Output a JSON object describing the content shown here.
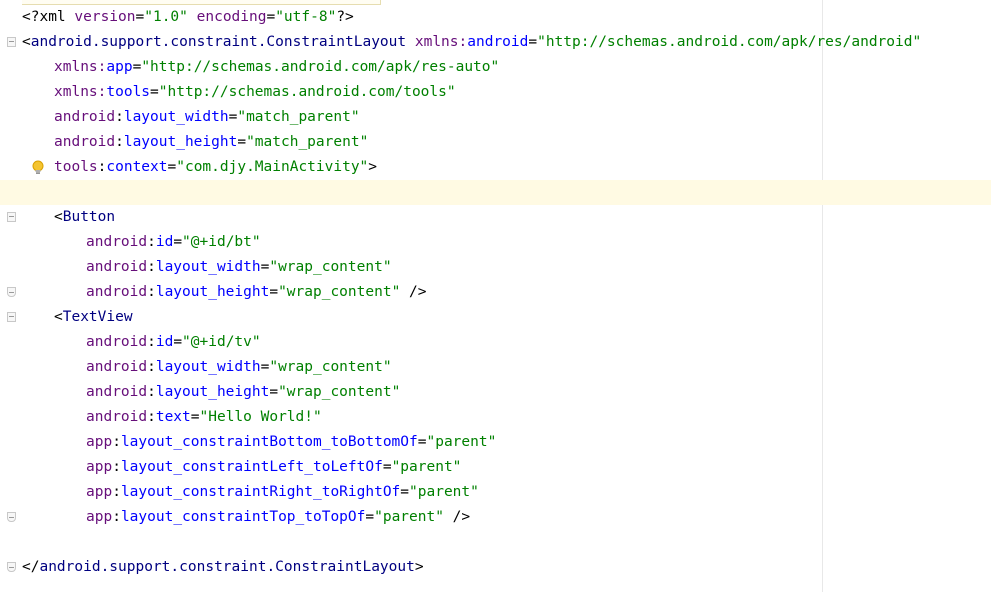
{
  "editor": {
    "lines": [
      {
        "indent": 0,
        "segments": [
          [
            "pi",
            "<?xml "
          ],
          [
            "an",
            "version"
          ],
          [
            "pi",
            "="
          ],
          [
            "av",
            "\"1.0\""
          ],
          [
            "pi",
            " "
          ],
          [
            "an",
            "encoding"
          ],
          [
            "pi",
            "="
          ],
          [
            "av",
            "\"utf-8\""
          ],
          [
            "pi",
            "?>"
          ]
        ]
      },
      {
        "indent": 0,
        "fold": "open",
        "segments": [
          [
            "bracket",
            "<"
          ],
          [
            "tag",
            "android.support.constraint.ConstraintLayout"
          ],
          [
            "pi",
            " "
          ],
          [
            "an",
            "xmlns:"
          ],
          [
            "al",
            "android"
          ],
          [
            "pi",
            "="
          ],
          [
            "av",
            "\"http://schemas.android.com/apk/res/android\""
          ]
        ]
      },
      {
        "indent": 1,
        "segments": [
          [
            "an",
            "xmlns:"
          ],
          [
            "al",
            "app"
          ],
          [
            "pi",
            "="
          ],
          [
            "av",
            "\"http://schemas.android.com/apk/res-auto\""
          ]
        ]
      },
      {
        "indent": 1,
        "segments": [
          [
            "an",
            "xmlns:"
          ],
          [
            "al",
            "tools"
          ],
          [
            "pi",
            "="
          ],
          [
            "av",
            "\"http://schemas.android.com/tools\""
          ]
        ]
      },
      {
        "indent": 1,
        "segments": [
          [
            "an",
            "android"
          ],
          [
            "pi",
            ":"
          ],
          [
            "al",
            "layout_width"
          ],
          [
            "pi",
            "="
          ],
          [
            "av",
            "\"match_parent\""
          ]
        ]
      },
      {
        "indent": 1,
        "segments": [
          [
            "an",
            "android"
          ],
          [
            "pi",
            ":"
          ],
          [
            "al",
            "layout_height"
          ],
          [
            "pi",
            "="
          ],
          [
            "av",
            "\"match_parent\""
          ]
        ]
      },
      {
        "indent": 1,
        "bulb": true,
        "segments": [
          [
            "an",
            "tools"
          ],
          [
            "pi",
            ":"
          ],
          [
            "al",
            "context"
          ],
          [
            "pi",
            "="
          ],
          [
            "av",
            "\"com.djy.MainActivity\""
          ],
          [
            "bracket",
            ">"
          ]
        ]
      },
      {
        "indent": 0,
        "current": true,
        "segments": []
      },
      {
        "indent": 1,
        "fold": "open",
        "segments": [
          [
            "bracket",
            "<"
          ],
          [
            "tag",
            "Button"
          ]
        ]
      },
      {
        "indent": 2,
        "segments": [
          [
            "an",
            "android"
          ],
          [
            "pi",
            ":"
          ],
          [
            "al",
            "id"
          ],
          [
            "pi",
            "="
          ],
          [
            "av",
            "\"@+id/bt\""
          ]
        ]
      },
      {
        "indent": 2,
        "segments": [
          [
            "an",
            "android"
          ],
          [
            "pi",
            ":"
          ],
          [
            "al",
            "layout_width"
          ],
          [
            "pi",
            "="
          ],
          [
            "av",
            "\"wrap_content\""
          ]
        ]
      },
      {
        "indent": 2,
        "fold": "close",
        "segments": [
          [
            "an",
            "android"
          ],
          [
            "pi",
            ":"
          ],
          [
            "al",
            "layout_height"
          ],
          [
            "pi",
            "="
          ],
          [
            "av",
            "\"wrap_content\""
          ],
          [
            "pi",
            " />"
          ]
        ]
      },
      {
        "indent": 1,
        "fold": "open",
        "segments": [
          [
            "bracket",
            "<"
          ],
          [
            "tag",
            "TextView"
          ]
        ]
      },
      {
        "indent": 2,
        "segments": [
          [
            "an",
            "android"
          ],
          [
            "pi",
            ":"
          ],
          [
            "al",
            "id"
          ],
          [
            "pi",
            "="
          ],
          [
            "av",
            "\"@+id/tv\""
          ]
        ]
      },
      {
        "indent": 2,
        "segments": [
          [
            "an",
            "android"
          ],
          [
            "pi",
            ":"
          ],
          [
            "al",
            "layout_width"
          ],
          [
            "pi",
            "="
          ],
          [
            "av",
            "\"wrap_content\""
          ]
        ]
      },
      {
        "indent": 2,
        "segments": [
          [
            "an",
            "android"
          ],
          [
            "pi",
            ":"
          ],
          [
            "al",
            "layout_height"
          ],
          [
            "pi",
            "="
          ],
          [
            "av",
            "\"wrap_content\""
          ]
        ]
      },
      {
        "indent": 2,
        "segments": [
          [
            "an",
            "android"
          ],
          [
            "pi",
            ":"
          ],
          [
            "al",
            "text"
          ],
          [
            "pi",
            "="
          ],
          [
            "av",
            "\"Hello World!\""
          ]
        ]
      },
      {
        "indent": 2,
        "segments": [
          [
            "an",
            "app"
          ],
          [
            "pi",
            ":"
          ],
          [
            "al",
            "layout_constraintBottom_toBottomOf"
          ],
          [
            "pi",
            "="
          ],
          [
            "av",
            "\"parent\""
          ]
        ]
      },
      {
        "indent": 2,
        "segments": [
          [
            "an",
            "app"
          ],
          [
            "pi",
            ":"
          ],
          [
            "al",
            "layout_constraintLeft_toLeftOf"
          ],
          [
            "pi",
            "="
          ],
          [
            "av",
            "\"parent\""
          ]
        ]
      },
      {
        "indent": 2,
        "segments": [
          [
            "an",
            "app"
          ],
          [
            "pi",
            ":"
          ],
          [
            "al",
            "layout_constraintRight_toRightOf"
          ],
          [
            "pi",
            "="
          ],
          [
            "av",
            "\"parent\""
          ]
        ]
      },
      {
        "indent": 2,
        "fold": "close",
        "segments": [
          [
            "an",
            "app"
          ],
          [
            "pi",
            ":"
          ],
          [
            "al",
            "layout_constraintTop_toTopOf"
          ],
          [
            "pi",
            "="
          ],
          [
            "av",
            "\"parent\""
          ],
          [
            "pi",
            " />"
          ]
        ]
      },
      {
        "indent": 0,
        "segments": []
      },
      {
        "indent": 0,
        "fold": "close",
        "segments": [
          [
            "bracket",
            "</"
          ],
          [
            "tag",
            "android.support.constraint.ConstraintLayout"
          ],
          [
            "bracket",
            ">"
          ]
        ]
      }
    ]
  },
  "colors": {
    "tag": "#000080",
    "attribute_namespace": "#660e7a",
    "attribute_local": "#0000ff",
    "attribute_value": "#008000",
    "current_line": "#fffae3"
  },
  "icons": {
    "intention": "lightbulb-icon",
    "fold": "fold-marker-icon"
  }
}
